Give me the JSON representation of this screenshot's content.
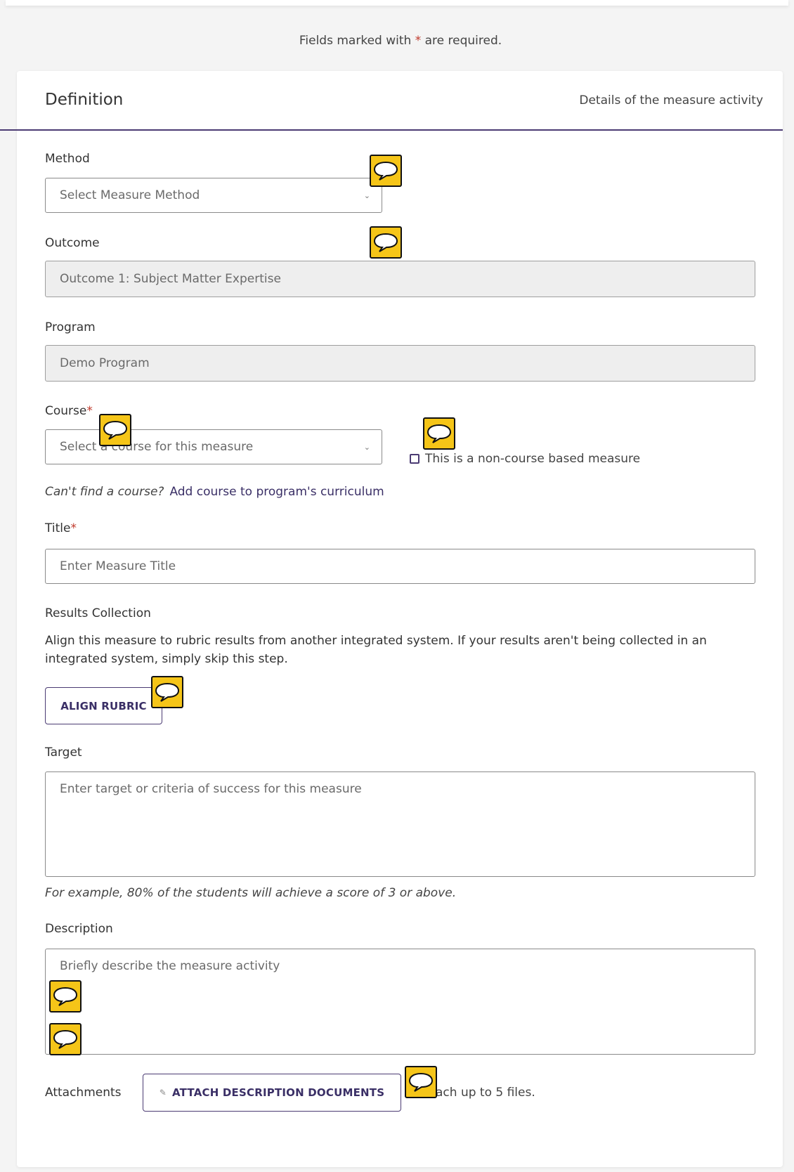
{
  "required_note": {
    "prefix": "Fields marked with ",
    "star": "*",
    "suffix": " are required."
  },
  "card": {
    "title": "Definition",
    "subtitle": "Details of the measure activity"
  },
  "method": {
    "label": "Method",
    "placeholder": "Select Measure Method"
  },
  "outcome": {
    "label": "Outcome",
    "value": "Outcome 1: Subject Matter Expertise"
  },
  "program": {
    "label": "Program",
    "value": "Demo Program"
  },
  "course": {
    "label": "Course",
    "star": "*",
    "placeholder": "Select a course for this measure",
    "non_course_label": "This is a non-course based measure",
    "help_text": "Can't find a course?",
    "help_link": "Add course to program's curriculum"
  },
  "title_field": {
    "label": "Title",
    "star": "*",
    "placeholder": "Enter Measure Title"
  },
  "results_collection": {
    "label": "Results Collection",
    "description": "Align this measure to rubric results from another integrated system. If your results aren't being collected in an integrated system, simply skip this step.",
    "button": "ALIGN RUBRIC"
  },
  "target": {
    "label": "Target",
    "placeholder": "Enter target or criteria of success for this measure",
    "example": "For example, 80% of the students will achieve a score of 3 or above."
  },
  "description": {
    "label": "Description",
    "placeholder": "Briefly describe the measure activity"
  },
  "attachments": {
    "label": "Attachments",
    "button": "ATTACH DESCRIPTION DOCUMENTS",
    "button_icon": "paperclip-icon",
    "limit_text": "ach up to 5 files."
  },
  "colors": {
    "accent": "#4b3b73",
    "link": "#3a2f66",
    "required": "#c0392b",
    "comment_marker": "#f5c518"
  }
}
